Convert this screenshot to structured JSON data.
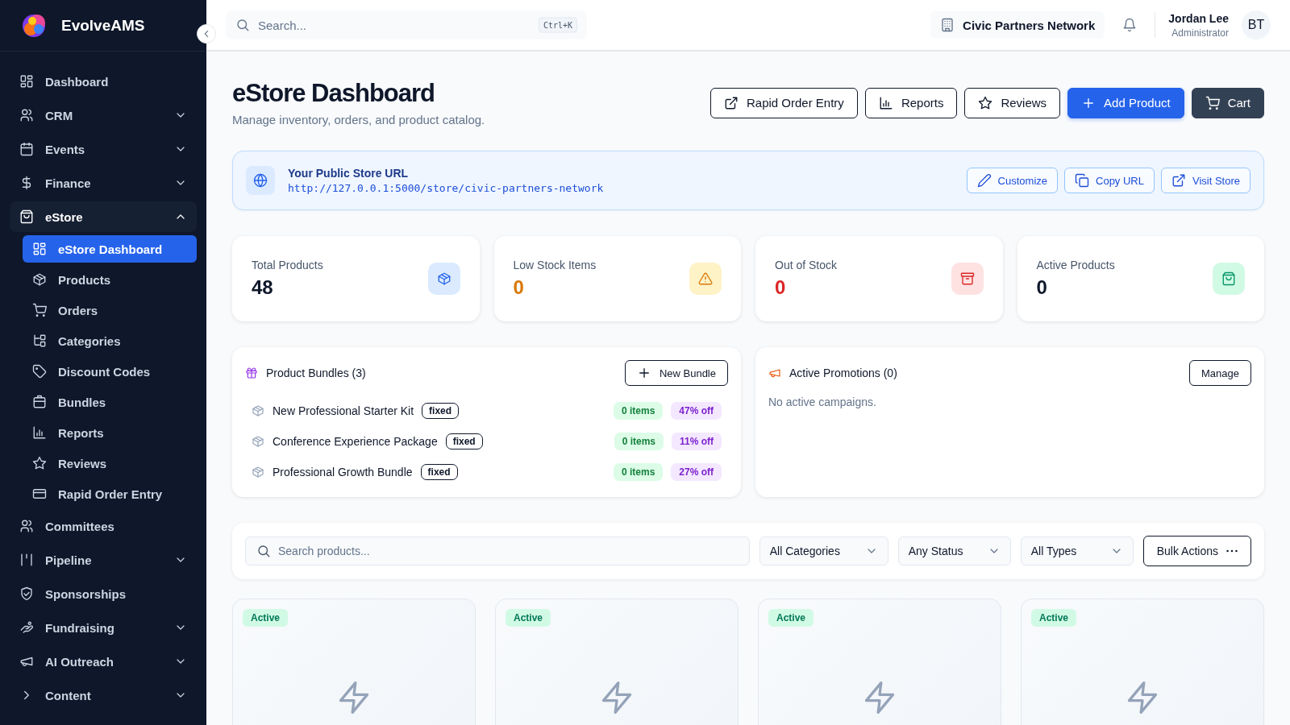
{
  "sidebar": {
    "brand": "EvolveAMS",
    "items": [
      {
        "kind": "link",
        "label": "Dashboard"
      },
      {
        "kind": "group",
        "label": "CRM",
        "expanded": false
      },
      {
        "kind": "group",
        "label": "Events",
        "expanded": false
      },
      {
        "kind": "group",
        "label": "Finance",
        "expanded": false
      },
      {
        "kind": "group",
        "label": "eStore",
        "expanded": true,
        "children": [
          {
            "label": "eStore Dashboard",
            "selected": true
          },
          {
            "label": "Products",
            "selected": false
          },
          {
            "label": "Orders",
            "selected": false
          },
          {
            "label": "Categories",
            "selected": false
          },
          {
            "label": "Discount Codes",
            "selected": false
          },
          {
            "label": "Bundles",
            "selected": false
          },
          {
            "label": "Reports",
            "selected": false
          },
          {
            "label": "Reviews",
            "selected": false
          },
          {
            "label": "Rapid Order Entry",
            "selected": false
          }
        ]
      },
      {
        "kind": "link",
        "label": "Committees"
      },
      {
        "kind": "group",
        "label": "Pipeline",
        "expanded": false
      },
      {
        "kind": "link",
        "label": "Sponsorships"
      },
      {
        "kind": "group",
        "label": "Fundraising",
        "expanded": false
      },
      {
        "kind": "group",
        "label": "AI Outreach",
        "expanded": false
      },
      {
        "kind": "group",
        "label": "Content",
        "expanded": false
      }
    ]
  },
  "topbar": {
    "search": {
      "placeholder": "Search...",
      "shortcut": "Ctrl+K"
    },
    "organization": "Civic Partners Network",
    "user": {
      "name": "Jordan Lee",
      "role": "Administrator",
      "initials": "BT"
    }
  },
  "header": {
    "title": "eStore Dashboard",
    "subtitle": "Manage inventory, orders, and product catalog.",
    "buttons": [
      {
        "kind": "outline",
        "label": "Rapid Order Entry"
      },
      {
        "kind": "outline",
        "label": "Reports"
      },
      {
        "kind": "outline",
        "label": "Reviews"
      },
      {
        "kind": "primary",
        "label": "Add Product"
      },
      {
        "kind": "dark",
        "label": "Cart"
      }
    ]
  },
  "store_url": {
    "title": "Your Public Store URL",
    "url": "http://127.0.0.1:5000/store/civic-partners-network",
    "buttons": [
      {
        "label": "Customize"
      },
      {
        "label": "Copy URL"
      },
      {
        "label": "Visit Store"
      }
    ]
  },
  "stats": [
    {
      "label": "Total Products",
      "value": "48",
      "color": "#0f172a"
    },
    {
      "label": "Low Stock Items",
      "value": "0",
      "color": "#d97706"
    },
    {
      "label": "Out of Stock",
      "value": "0",
      "color": "#dc2626"
    },
    {
      "label": "Active Products",
      "value": "0",
      "color": "#0f172a"
    }
  ],
  "bundles": {
    "title": "Product Bundles (3)",
    "button": "New Bundle",
    "rows": [
      {
        "name": "New Professional Starter Kit",
        "type": "fixed",
        "items": "0 items",
        "discount": "47% off"
      },
      {
        "name": "Conference Experience Package",
        "type": "fixed",
        "items": "0 items",
        "discount": "11% off"
      },
      {
        "name": "Professional Growth Bundle",
        "type": "fixed",
        "items": "0 items",
        "discount": "27% off"
      }
    ]
  },
  "promotions": {
    "title": "Active Promotions (0)",
    "button": "Manage",
    "empty": "No active campaigns."
  },
  "filters": {
    "search": {
      "placeholder": "Search products..."
    },
    "selects": [
      "All Categories",
      "Any Status",
      "All Types"
    ],
    "bulk": "Bulk Actions"
  },
  "products": [
    {
      "status": "Active"
    },
    {
      "status": "Active"
    },
    {
      "status": "Active"
    },
    {
      "status": "Active"
    }
  ]
}
